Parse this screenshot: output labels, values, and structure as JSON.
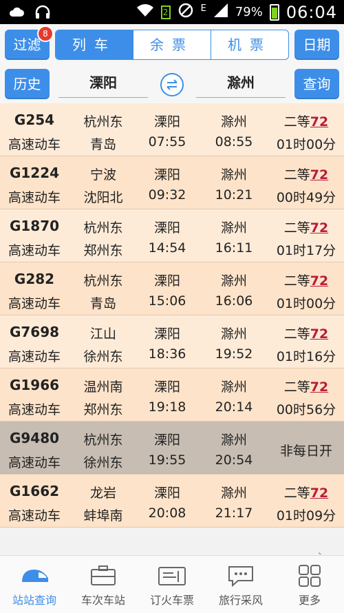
{
  "status_bar": {
    "battery": "79%",
    "time": "06:04",
    "network": "E",
    "sim": "2",
    "icons": [
      "weather-icon",
      "headphones-icon",
      "wifi-icon",
      "sim-icon",
      "blocked-icon",
      "signal-icon",
      "battery-icon"
    ]
  },
  "toolbar": {
    "filter_label": "过滤",
    "filter_badge": "8",
    "tabs": [
      "列车",
      "余票",
      "机票"
    ],
    "date_label": "日期",
    "history_label": "历史",
    "from_station": "溧阳",
    "to_station": "滁州",
    "query_label": "查询"
  },
  "trains": [
    {
      "no": "G254",
      "type": "高速动车",
      "origin": "杭州东",
      "dest": "青岛",
      "from": "溧阳",
      "dep": "07:55",
      "to": "滁州",
      "arr": "08:55",
      "seat": "二等",
      "count": "72",
      "duration": "01时00分"
    },
    {
      "no": "G1224",
      "type": "高速动车",
      "origin": "宁波",
      "dest": "沈阳北",
      "from": "溧阳",
      "dep": "09:32",
      "to": "滁州",
      "arr": "10:21",
      "seat": "二等",
      "count": "72",
      "duration": "00时49分"
    },
    {
      "no": "G1870",
      "type": "高速动车",
      "origin": "杭州东",
      "dest": "郑州东",
      "from": "溧阳",
      "dep": "14:54",
      "to": "滁州",
      "arr": "16:11",
      "seat": "二等",
      "count": "72",
      "duration": "01时17分"
    },
    {
      "no": "G282",
      "type": "高速动车",
      "origin": "杭州东",
      "dest": "青岛",
      "from": "溧阳",
      "dep": "15:06",
      "to": "滁州",
      "arr": "16:06",
      "seat": "二等",
      "count": "72",
      "duration": "01时00分"
    },
    {
      "no": "G7698",
      "type": "高速动车",
      "origin": "江山",
      "dest": "徐州东",
      "from": "溧阳",
      "dep": "18:36",
      "to": "滁州",
      "arr": "19:52",
      "seat": "二等",
      "count": "72",
      "duration": "01时16分"
    },
    {
      "no": "G1966",
      "type": "高速动车",
      "origin": "温州南",
      "dest": "郑州东",
      "from": "溧阳",
      "dep": "19:18",
      "to": "滁州",
      "arr": "20:14",
      "seat": "二等",
      "count": "72",
      "duration": "00时56分"
    },
    {
      "no": "G9480",
      "type": "高速动车",
      "origin": "杭州东",
      "dest": "徐州东",
      "from": "溧阳",
      "dep": "19:55",
      "to": "滁州",
      "arr": "20:54",
      "note": "非每日开"
    },
    {
      "no": "G1662",
      "type": "高速动车",
      "origin": "龙岩",
      "dest": "蚌埠南",
      "from": "溧阳",
      "dep": "20:08",
      "to": "滁州",
      "arr": "21:17",
      "seat": "二等",
      "count": "72",
      "duration": "01时09分"
    }
  ],
  "more_link": {
    "label": "",
    "arrow": "›"
  },
  "tabbar": [
    {
      "label": "站站查询",
      "icon": "train-icon",
      "active": true
    },
    {
      "label": "车次车站",
      "icon": "briefcase-icon",
      "active": false
    },
    {
      "label": "订火车票",
      "icon": "ticket-icon",
      "active": false
    },
    {
      "label": "旅行采风",
      "icon": "chat-icon",
      "active": false
    },
    {
      "label": "更多",
      "icon": "grid-icon",
      "active": false
    }
  ],
  "colors": {
    "accent": "#3d8ee8",
    "row_a": "#fdebd8",
    "row_b": "#fde3c9",
    "row_disabled": "#c7bdb2",
    "count": "#b81c3a"
  }
}
